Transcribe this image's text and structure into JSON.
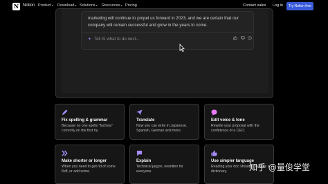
{
  "nav": {
    "logo_letter": "N",
    "brand": "Notion",
    "items": [
      {
        "label": "Product",
        "dropdown": true
      },
      {
        "label": "Download",
        "dropdown": true
      },
      {
        "label": "Solutions",
        "dropdown": true
      },
      {
        "label": "Resources",
        "dropdown": true
      },
      {
        "label": "Pricing",
        "dropdown": false
      }
    ],
    "contact_sales": "Contact sales",
    "log_in": "Log in",
    "try_free": "Try Notion free"
  },
  "ai_card": {
    "text": "marketing will continue to propel us forward in 2023, and we are certain that our company will remain successful and grow in the years to come.",
    "input_placeholder": "Tell AI what to do next...",
    "actions": [
      "thumbs-up-icon",
      "thumbs-down-icon",
      "more-icon"
    ]
  },
  "features": [
    {
      "title": "Fix spelling & grammar",
      "desc": "Because no one spells \"fuchsia\" correctly on the first try.",
      "icon": "pencil-icon",
      "color": "#a78bfa"
    },
    {
      "title": "Translate",
      "desc": "Now you can write in Japanese, Spanish, German and more.",
      "icon": "send-icon",
      "color": "#a78bfa"
    },
    {
      "title": "Edit voice & tone",
      "desc": "Rewrite your proposal with the confidence of a CEO.",
      "icon": "speech-bubble-icon",
      "color": "#a78bfa"
    },
    {
      "title": "Make shorter or longer",
      "desc": "When you need to get rid of some fluff, or add some.",
      "icon": "double-chevron-icon",
      "color": "#a78bfa"
    },
    {
      "title": "Explain",
      "desc": "Technical jargon, rewritten for everyone.",
      "icon": "chat-icon",
      "color": "#a78bfa"
    },
    {
      "title": "Use simpler language",
      "desc": "Reading your doc shouldn't require a dictionary.",
      "icon": "thumb-icon",
      "color": "#a78bfa"
    }
  ],
  "watermark": "知乎 @量俊学堂",
  "colors": {
    "accent": "#3b5bdb",
    "icon_purple": "#a78bfa",
    "background": "#000000"
  }
}
